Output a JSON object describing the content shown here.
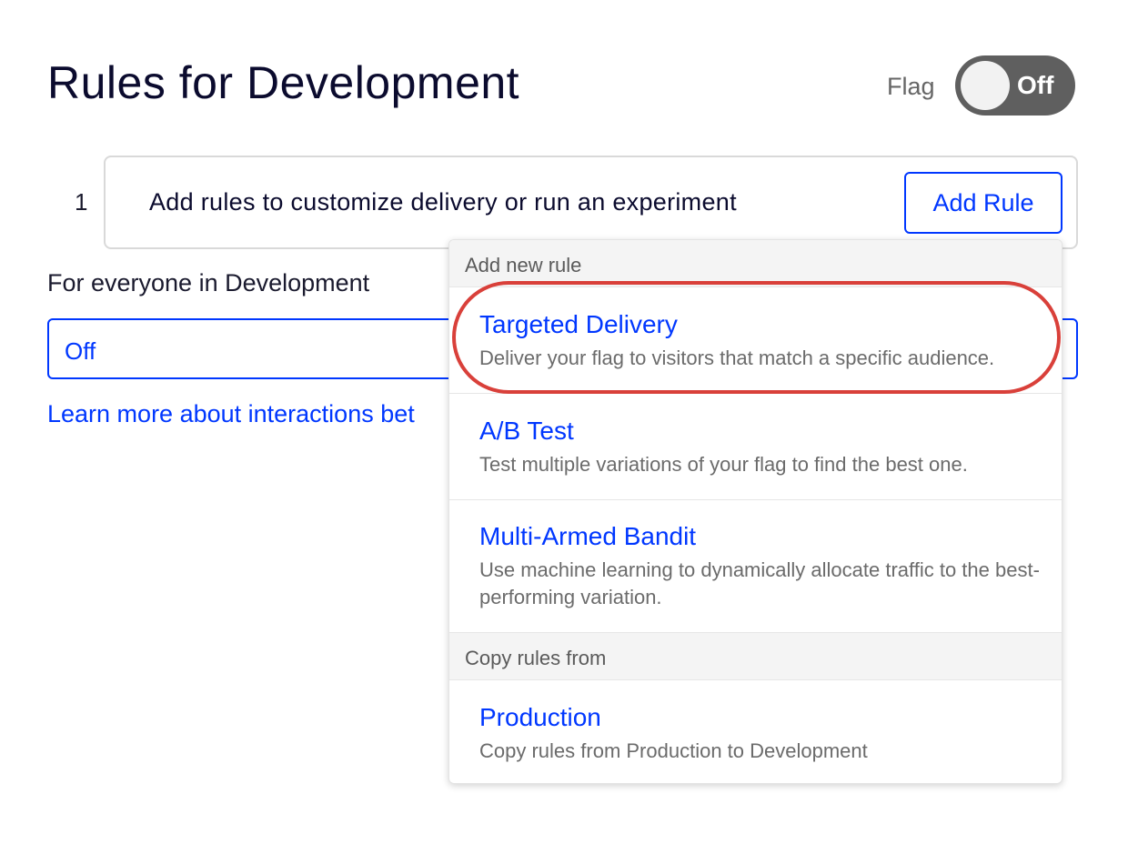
{
  "page": {
    "title": "Rules for Development"
  },
  "flag": {
    "label": "Flag",
    "toggle_text": "Off",
    "state": "off"
  },
  "rule": {
    "number": "1",
    "text": "Add rules to customize delivery or run an experiment",
    "add_button": "Add Rule"
  },
  "everyone": {
    "label": "For everyone in Development",
    "select_value": "Off"
  },
  "learn_more": {
    "text": "Learn more about interactions bet"
  },
  "dropdown": {
    "section_new": "Add new rule",
    "items": [
      {
        "title": "Targeted Delivery",
        "description": "Deliver your flag to visitors that match a specific audience."
      },
      {
        "title": "A/B Test",
        "description": "Test multiple variations of your flag to find the best one."
      },
      {
        "title": "Multi-Armed Bandit",
        "description": "Use machine learning to dynamically allocate traffic to the best-performing variation."
      }
    ],
    "section_copy": "Copy rules from",
    "copy_items": [
      {
        "title": "Production",
        "description": "Copy rules from Production to Development"
      }
    ]
  },
  "colors": {
    "accent": "#0037ff",
    "toggle_off": "#5f5f5f",
    "highlight": "#d9403a",
    "text": "#0b0b2e",
    "muted": "#6b6b6b"
  }
}
